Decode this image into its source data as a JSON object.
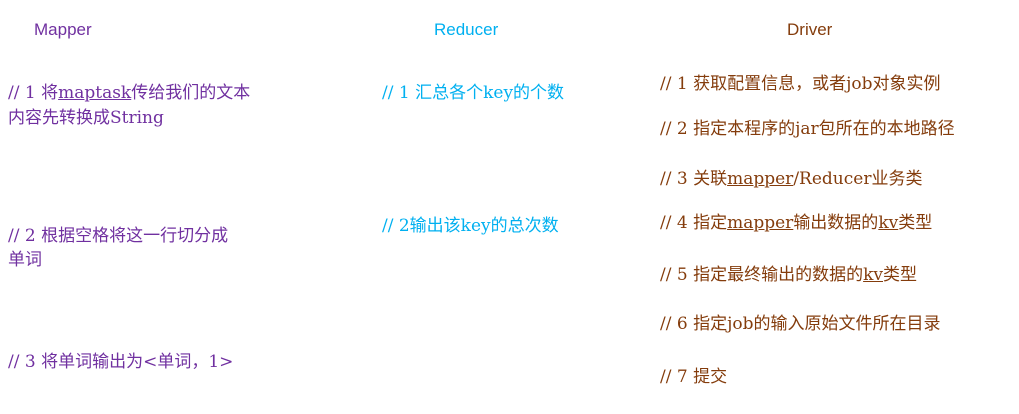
{
  "colors": {
    "mapper": "#7030a0",
    "reducer": "#00b0f0",
    "driver": "#843c0c"
  },
  "headers": {
    "mapper": "Mapper",
    "reducer": "Reducer",
    "driver": "Driver"
  },
  "mapper": {
    "step1": {
      "prefix": "// 1 将",
      "underlined": "maptask",
      "rest": "传给我们的文本",
      "line2": "内容先转换成String"
    },
    "step2": {
      "line1": "// 2 根据空格将这一行切分成",
      "line2": "单词"
    },
    "step3": "// 3 将单词输出为<单词，1>"
  },
  "reducer": {
    "step1": "// 1 汇总各个key的个数",
    "step2": "// 2输出该key的总次数"
  },
  "driver": {
    "step1": "// 1 获取配置信息，或者job对象实例",
    "step2": "// 2 指定本程序的jar包所在的本地路径",
    "step3": {
      "prefix": "// 3 关联",
      "underlined": "mapper",
      "rest": "/Reducer业务类"
    },
    "step4": {
      "prefix": "// 4 指定",
      "underlined": "mapper",
      "mid": "输出数据的",
      "underlined2": "kv",
      "rest": "类型"
    },
    "step5": {
      "prefix": "// 5 指定最终输出的数据的",
      "underlined": "kv",
      "rest": "类型"
    },
    "step6": "// 6 指定job的输入原始文件所在目录",
    "step7": "// 7 提交"
  }
}
